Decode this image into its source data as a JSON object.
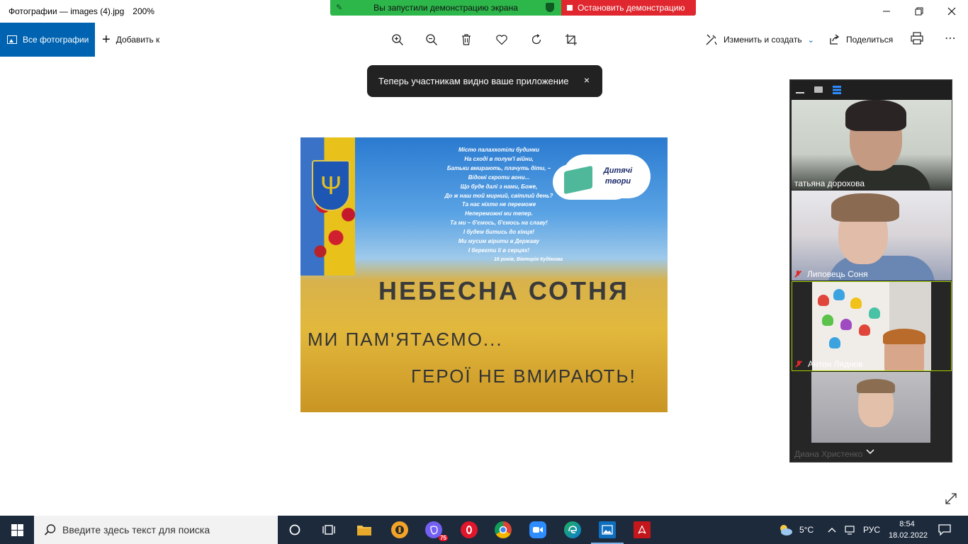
{
  "window": {
    "title": "Фотографии — images (4).jpg",
    "zoom": "200%"
  },
  "share_banner": {
    "status": "Вы запустили демонстрацию экрана",
    "stop_label": "Остановить демонстрацию",
    "colors": {
      "green": "#2db74b",
      "red": "#e0262e"
    }
  },
  "toolbar": {
    "all_photos": "Все фотографии",
    "add_to": "Добавить к",
    "edit_create": "Изменить и создать",
    "share": "Поделиться",
    "accent": "#0063b1",
    "tools": [
      "zoom-in-icon",
      "zoom-out-icon",
      "delete-icon",
      "favorite-icon",
      "rotate-icon",
      "crop-icon"
    ]
  },
  "toast": {
    "message": "Теперь участникам видно ваше приложение",
    "close": "×"
  },
  "photo": {
    "poem": [
      "Місто палахкотіли будинки",
      "На сході в полум'ї війни,",
      "Батьки вмирають, плачуть діти, –",
      "Відомі скроти вони...",
      "Що буде далі з нами, Боже,",
      "До ж наш той мирний, світлий день?",
      "Та нас ніхто не переможе",
      "Непереможні ми тепер.",
      "Та ми – б'ємось, б'ємось на славу!",
      "І будем битись до кінця!",
      "Ми мусим вірити в Державу",
      "І берегти її в серцях!"
    ],
    "poem_author": "16 років, Вікторія Кудімова",
    "cloud_text_line1": "Дитячі",
    "cloud_text_line2": "твори",
    "heading": "НЕБЕСНА СОТНЯ",
    "subtitle1": "МИ ПАМ'ЯТАЄМО...",
    "subtitle2": "ГЕРОЇ НЕ ВМИРАЮТЬ!"
  },
  "zoom_panel": {
    "participants": [
      {
        "name": "татьяна дорохова",
        "muted": false
      },
      {
        "name": "Липовець Соня",
        "muted": true
      },
      {
        "name": "Антон Ляднов",
        "muted": true,
        "active_speaker": true
      },
      {
        "name": "Диана Христенко",
        "muted": false
      }
    ],
    "active_border_color": "#a6d000"
  },
  "taskbar": {
    "search_placeholder": "Введите здесь текст для поиска",
    "viber_badge": "75",
    "weather": "5°C",
    "language": "РУС",
    "time": "8:54",
    "date": "18.02.2022"
  }
}
